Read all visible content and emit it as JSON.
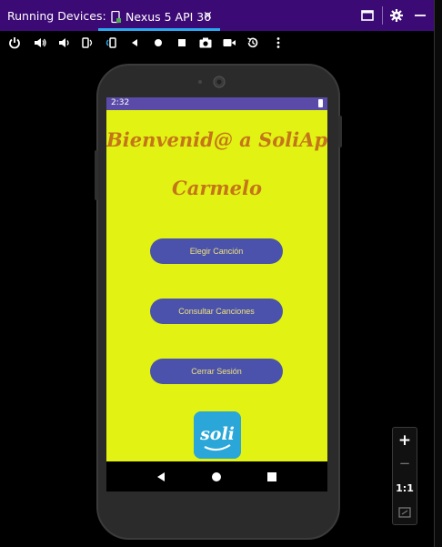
{
  "window": {
    "panel_title": "Running Devices:",
    "tab_label": "Nexus 5 API 30",
    "tab_close": "×"
  },
  "toolbar_icons": [
    "power-icon",
    "volume-up-icon",
    "volume-down-icon",
    "rotate-left-icon",
    "rotate-right-icon",
    "back-icon",
    "home-icon",
    "overview-icon",
    "camera-icon",
    "record-icon",
    "snapshot-icon",
    "more-icon"
  ],
  "device": {
    "status_time": "2:32",
    "welcome_text": "Bienvenid@ a SoliApp",
    "user_name": "Carmelo",
    "buttons": {
      "choose_song": "Elegir Canción",
      "consult_songs": "Consultar Canciones",
      "logout": "Cerrar Sesión"
    },
    "logo_text": "soli"
  },
  "zoom": {
    "zoom_in": "+",
    "zoom_out": "−",
    "actual_size": "1:1"
  },
  "colors": {
    "title_bar": "#3c0a75",
    "tab_underline": "#29a8f2",
    "screen_bg": "#e2f212",
    "status_bar": "#5a4ba8",
    "welcome_text": "#c4751a",
    "button_bg": "#4a52ac",
    "button_text": "#f0e07a",
    "logo_bg": "#2aa7d8"
  }
}
